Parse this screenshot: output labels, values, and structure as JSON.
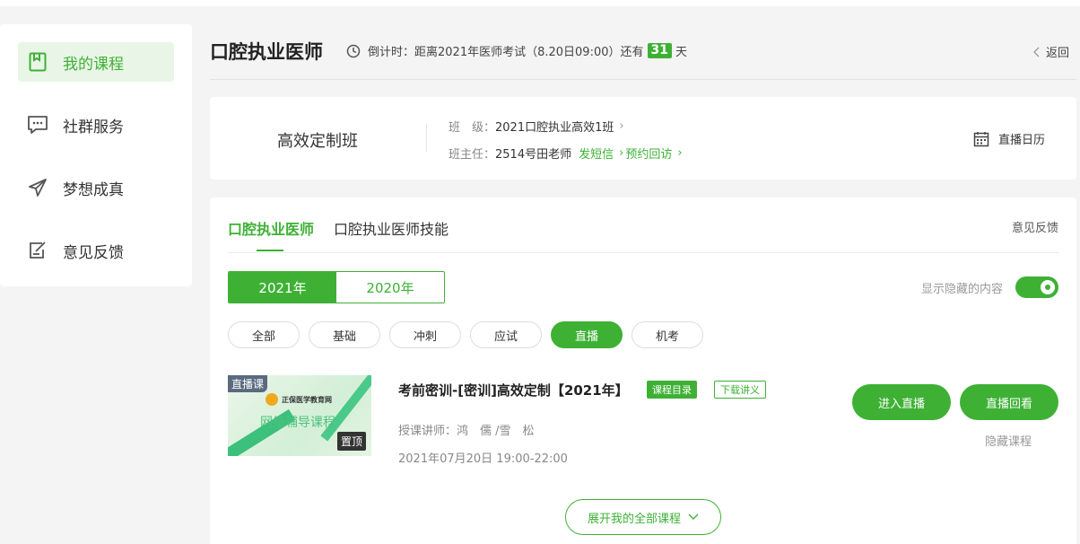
{
  "sidebar": {
    "items": [
      {
        "label": "我的课程",
        "icon": "bookmark-icon",
        "active": true
      },
      {
        "label": "社群服务",
        "icon": "chat-icon"
      },
      {
        "label": "梦想成真",
        "icon": "send-icon"
      },
      {
        "label": "意见反馈",
        "icon": "edit-icon"
      }
    ]
  },
  "header": {
    "title": "口腔执业医师",
    "countdown_prefix": "倒计时：距离2021年医师考试（8.20日09:00）还有",
    "countdown_days": "31",
    "countdown_suffix": "天",
    "back_label": "返回"
  },
  "class_info": {
    "type": "高效定制班",
    "class_key": "班　级：",
    "class_value": "2021口腔执业高效1班",
    "teacher_key": "班主任：",
    "teacher_value": "2514号田老师",
    "sms_label": "发短信",
    "callback_label": "预约回访",
    "calendar_label": "直播日历"
  },
  "courses": {
    "tabs": [
      "口腔执业医师",
      "口腔执业医师技能"
    ],
    "feedback_label": "意见反馈",
    "years": [
      "2021年",
      "2020年"
    ],
    "show_hidden_label": "显示隐藏的内容",
    "filters": [
      "全部",
      "基础",
      "冲刺",
      "应试",
      "直播",
      "机考"
    ],
    "active_filter": "直播",
    "item": {
      "thumb_tag": "直播课",
      "thumb_brand": "正保医学教育网",
      "thumb_subtitle": "网络辅导课程",
      "thumb_pin": "置顶",
      "title": "考前密训-[密训]高效定制【2021年】",
      "catalog_label": "课程目录",
      "download_label": "下载讲义",
      "teachers": "授课讲师：鸿　儒 /雪　松",
      "datetime": "2021年07月20日 19:00-22:00",
      "enter_live_label": "进入直播",
      "replay_label": "直播回看",
      "hide_label": "隐藏课程"
    },
    "expand_label": "展开我的全部课程"
  },
  "colors": {
    "accent": "#3eb135",
    "bg": "#f4f4f4"
  }
}
